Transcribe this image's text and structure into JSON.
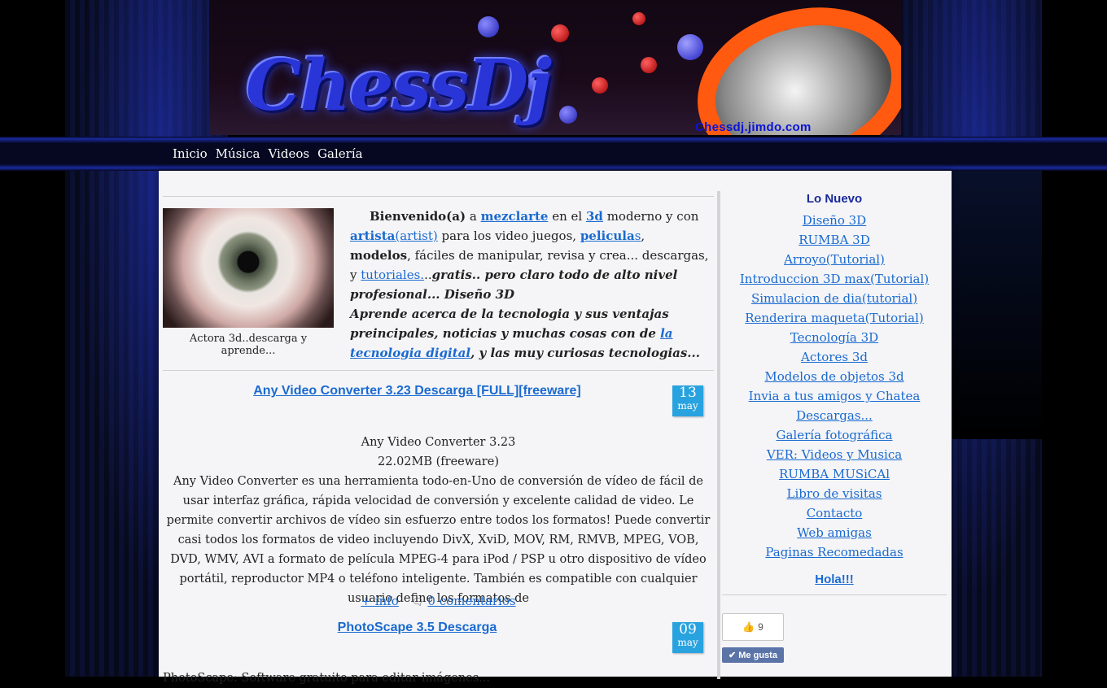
{
  "banner": {
    "logo_text": "ChessDj",
    "url_text": "Chessdj.jimdo.com"
  },
  "nav": {
    "items": [
      "Inicio",
      "Música",
      "Videos",
      "Galería"
    ]
  },
  "intro": {
    "caption": "Actora 3d..descarga y aprende...",
    "p1_bold": "Bienvenido(a)",
    "p1_a": " a ",
    "link_mezclarte": "mezclarte",
    "p1_b": " en el ",
    "link_3d": "3d",
    "p1_c": " moderno y con ",
    "link_artista": "artista",
    "link_artist": "(artist)",
    "p1_d": " para los video juegos, ",
    "link_peliculas": "pelicula",
    "link_peliculas_s": "s",
    "p1_e": ",",
    "bold_modelos": "modelos",
    "p1_f": ", fáciles de manipular, revisa y crea... descargas, y ",
    "link_tutoriales": "tutoriales.",
    "p1_g": "..",
    "italic_1": "gratis.. pero claro todo de alto nivel profesional... Diseño 3D",
    "italic_2": "Aprende acerca de la tecnologia y sus ventajas preincipales, noticias y muchas cosas con de ",
    "link_tecnologia": "la tecnologia digital",
    "italic_3": ", y las muy curiosas tecnologias..."
  },
  "posts": [
    {
      "title": "Any Video Converter 3.23 Descarga [FULL][freeware]",
      "day": "13",
      "month": "may",
      "line1": "Any Video Converter 3.23",
      "line2": "22.02MB (freeware)",
      "body": "Any Video Converter es una herramienta todo-en-Uno de conversión de vídeo de fácil de usar interfaz gráfica, rápida velocidad de conversión y excelente calidad de video. Le permite convertir archivos de vídeo sin esfuerzo entre todos los formatos! Puede convertir casi todos los formatos de video incluyendo DivX, XviD, MOV, RM, RMVB, MPEG, VOB, DVD, WMV, AVI a formato de película MPEG-4 para iPod / PSP u otro dispositivo de vídeo portátil, reproductor MP4 o teléfono inteligente. También es compatible con cualquier usuario define los formatos de",
      "more": "+ info",
      "comments": "0 comentarios"
    },
    {
      "title": "PhotoScape 3.5 Descarga",
      "day": "09",
      "month": "may",
      "body_partial": "PhotoScape: Software gratuito para editar imágenes..."
    }
  ],
  "sidebar": {
    "title": "Lo Nuevo",
    "links": [
      "Diseño 3D",
      "RUMBA 3D",
      "Arroyo(Tutorial)",
      "Introduccion 3D max(Tutorial)",
      "Simulacion de dia(tutorial)",
      "Renderira maqueta(Tutorial)",
      "Tecnología 3D",
      "Actores 3d",
      "Modelos de objetos 3d",
      "Invia a tus amigos y Chatea",
      "Descargas...",
      "Galería fotográfica",
      "VER: Videos y Musica",
      "RUMBA MUSiCAl",
      "Libro de visitas",
      "Contacto",
      "Web amigas",
      "Paginas Recomedadas"
    ],
    "hola": "Hola!!!",
    "like_count": "9",
    "like_label": "Me gusta"
  }
}
